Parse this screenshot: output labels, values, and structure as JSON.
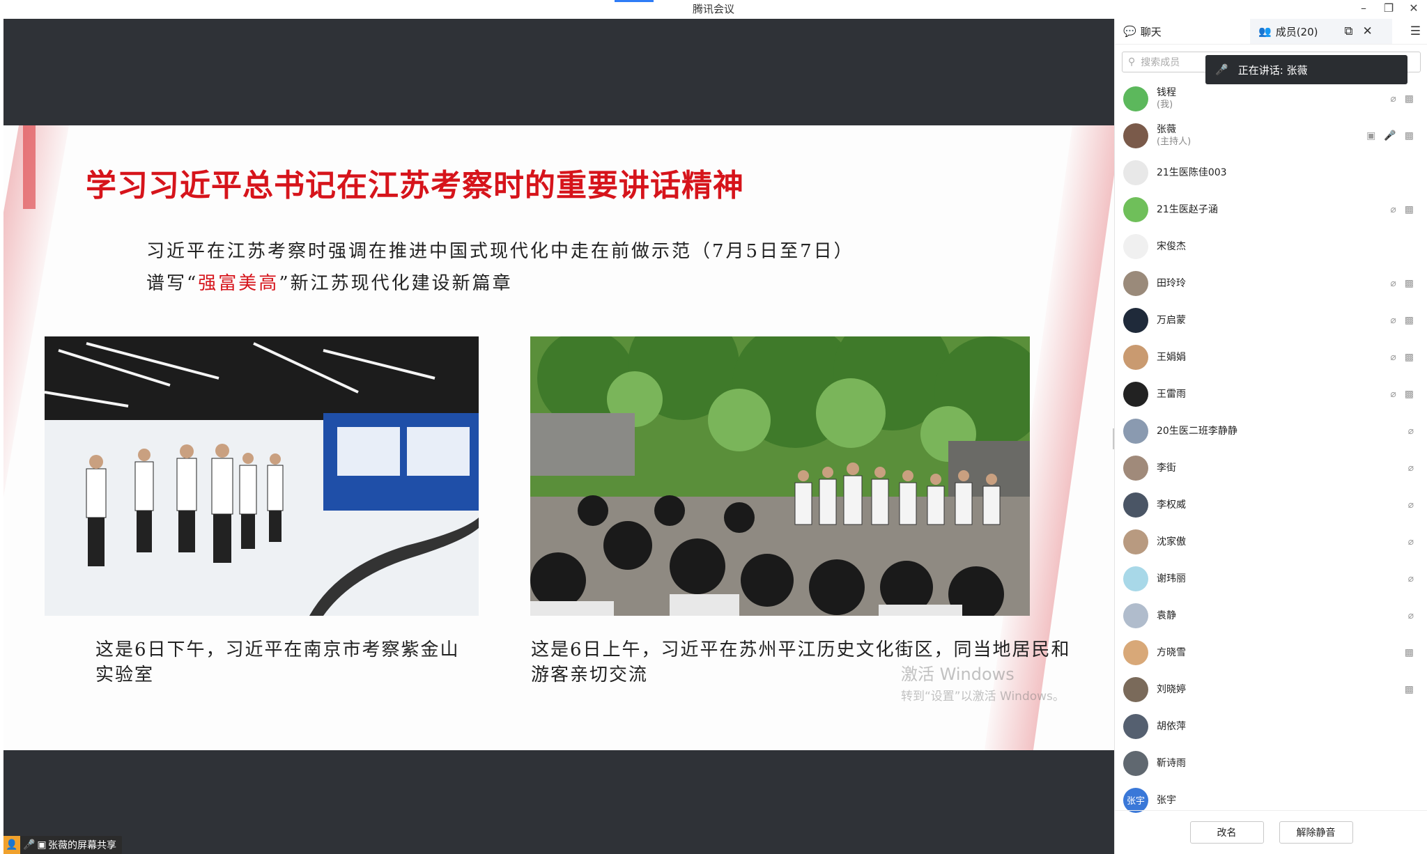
{
  "window": {
    "title": "腾讯会议"
  },
  "slide": {
    "title": "学习习近平总书记在江苏考察时的重要讲话精神",
    "subtitle1": "习近平在江苏考察时强调在推进中国式现代化中走在前做示范（7月5日至7日）",
    "subtitle2_prefix": "谱写“",
    "subtitle2_highlight": "强富美高",
    "subtitle2_suffix": "”新江苏现代化建设新篇章",
    "caption1": "这是6日下午，习近平在南京市考察紫金山实验室",
    "caption2": "这是6日上午，习近平在苏州平江历史文化街区，同当地居民和游客亲切交流",
    "watermark_line1": "激活 Windows",
    "watermark_line2": "转到“设置”以激活 Windows。",
    "accent_color": "#d6141b"
  },
  "share_badge": {
    "label": "张薇的屏幕共享"
  },
  "panel": {
    "tabs": [
      {
        "label": "聊天",
        "icon": "chat-icon"
      },
      {
        "label": "成员(20)",
        "icon": "members-icon"
      }
    ],
    "search_placeholder": "搜索成员",
    "speaking_label": "正在讲话:",
    "speaking_name": "张薇",
    "members": [
      {
        "name": "钱程",
        "role": "(我)",
        "avatar_color": "#5cb85c",
        "mic": "off",
        "cam": "off"
      },
      {
        "name": "张薇",
        "role": "(主持人)",
        "avatar_color": "#7a5a4a",
        "mic": "on",
        "cam": "off",
        "sharing": true
      },
      {
        "name": "21生医陈佳003",
        "role": "",
        "avatar_color": "#e8e8e8",
        "mic": "none",
        "cam": "none"
      },
      {
        "name": "21生医赵子涵",
        "role": "",
        "avatar_color": "#6fbf5a",
        "mic": "off",
        "cam": "off"
      },
      {
        "name": "宋俊杰",
        "role": "",
        "avatar_color": "#f0f0f0",
        "mic": "none",
        "cam": "none"
      },
      {
        "name": "田玲玲",
        "role": "",
        "avatar_color": "#9a8a7a",
        "mic": "off",
        "cam": "off"
      },
      {
        "name": "万启蒙",
        "role": "",
        "avatar_color": "#1f2a3a",
        "mic": "off",
        "cam": "off"
      },
      {
        "name": "王娟娟",
        "role": "",
        "avatar_color": "#c99a70",
        "mic": "off",
        "cam": "off"
      },
      {
        "name": "王雷雨",
        "role": "",
        "avatar_color": "#222222",
        "mic": "off",
        "cam": "off"
      },
      {
        "name": "20生医二班李静静",
        "role": "",
        "avatar_color": "#8a9ab0",
        "mic": "off",
        "cam": "none"
      },
      {
        "name": "李街",
        "role": "",
        "avatar_color": "#a08a7a",
        "mic": "off",
        "cam": "none"
      },
      {
        "name": "李权威",
        "role": "",
        "avatar_color": "#4a5565",
        "mic": "off",
        "cam": "none"
      },
      {
        "name": "沈家傲",
        "role": "",
        "avatar_color": "#b89a80",
        "mic": "off",
        "cam": "none"
      },
      {
        "name": "谢玮丽",
        "role": "",
        "avatar_color": "#a8d8e8",
        "mic": "off",
        "cam": "none"
      },
      {
        "name": "袁静",
        "role": "",
        "avatar_color": "#b0bccc",
        "mic": "off",
        "cam": "none"
      },
      {
        "name": "方晓雪",
        "role": "",
        "avatar_color": "#d8a878",
        "mic": "none",
        "cam": "off"
      },
      {
        "name": "刘晓婷",
        "role": "",
        "avatar_color": "#7a6a5a",
        "mic": "none",
        "cam": "off"
      },
      {
        "name": "胡依萍",
        "role": "",
        "avatar_color": "#556070",
        "mic": "none",
        "cam": "none"
      },
      {
        "name": "靳诗雨",
        "role": "",
        "avatar_color": "#606870",
        "mic": "none",
        "cam": "none"
      },
      {
        "name": "张宇",
        "role": "",
        "avatar_color": "#3a78d8",
        "avatar_text": "张宇",
        "mic": "none",
        "cam": "none"
      }
    ],
    "footer": {
      "rename": "改名",
      "unmute": "解除静音"
    }
  }
}
